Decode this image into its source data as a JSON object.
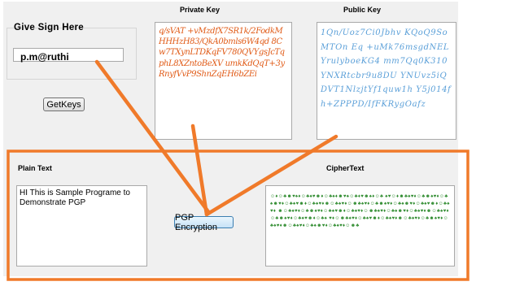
{
  "sign": {
    "title": "Give Sign Here",
    "value": "p.m@ruthi",
    "getkeys_label": "GetKeys"
  },
  "private_key": {
    "title": "Private Key",
    "text": "q/sVAT +vMzdfX7SR1k/2FodkMHHHzH83/QkA0bmls6W4qd 8Cw7TXynLTDKqFV780QVYgsJcTqphL8XZntoBeXV umkKdQqT+3yRnyfVvP9ShnZqEH6bZEi"
  },
  "public_key": {
    "title": "Public Key",
    "text": "1Qn/Uoz7Ci0Jbhv KQoQ9SoMTOn Eq +uMk76msgdNEL YrulyboeKG4 mm7Qq0K310YNXRtcbr9u8DU YNUvz5iQDVT1NlzjtYf1quw1h Y5j014fh+ZPPPD/IfFKRygOafz"
  },
  "plain": {
    "title": "Plain Text",
    "text": "HI This is Sample Programe to Demonstrate PGP"
  },
  "cipher": {
    "title": "CipherText",
    "text": "☺♦☺♣☻♥♠♦☺♣♠♥☻♦☺♣♠♦☻♥♠☺♣♦♥☻♠♦☺♣ ♠♥☺♦☻♣♠♥♦☺♣☻♠♥♦☺♣♠☻♥♦☺♣♠♥☻♦☺♣♠♥♦☻☺♣♠♥♦☺☻♣♠♥♦☺♣☻♠♥♦☺♣♠☻♥♦☺♣♠♥☻♦☺♣♠♥♦ ☻☺♣♠♥♦☺♣☻♠♥♦☺♣♠♥☻♦☺♣♠♥♦☺☻♣♠♥♦☺♣♠☻♥♦☺♣♠♥♦☻☺♣♠♥♦☺♣☻♠♥♦☺♣♠♥☻♦☺♣♠ ♥♦☺☻♣♠♥♦☺♣♠♥☻♦☺♣♠♥♦☻☺♣♠♥♦☺♣☻♠♥♦☺♣♠♥♦☻☺♣♠♥♦☺♣♠☻♥♦☺♣♠♥♦☺☻♣"
  },
  "encrypt": {
    "label": "PGP Encryption"
  },
  "colors": {
    "annotation": "#f07a2a",
    "form_bg": "#f0f0f0",
    "private_text": "#e05a16",
    "public_text": "#5a9fd8",
    "cipher_text": "#2e8b2e"
  }
}
